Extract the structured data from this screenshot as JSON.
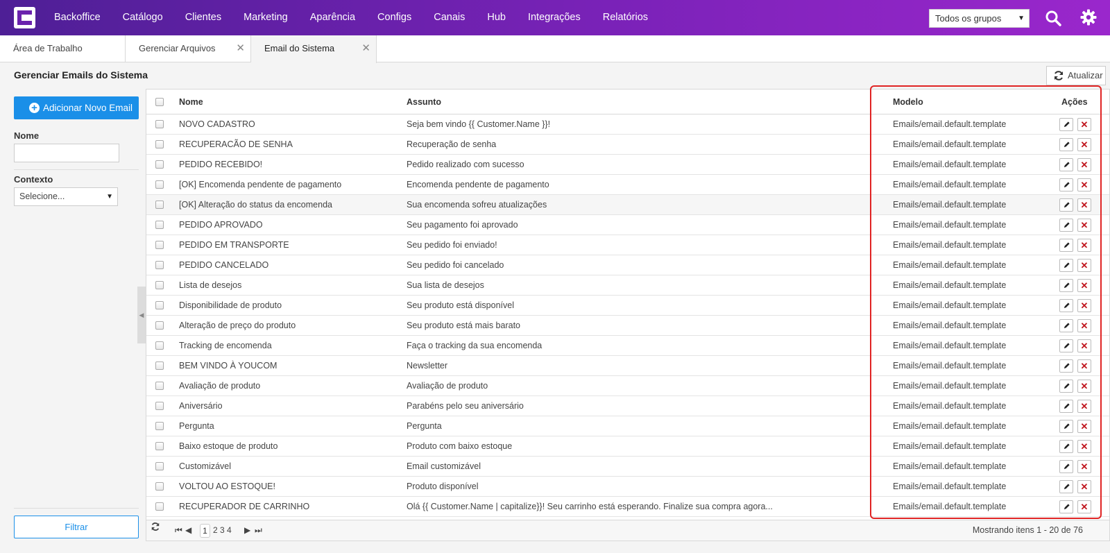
{
  "topbar": {
    "nav": [
      "Backoffice",
      "Catálogo",
      "Clientes",
      "Marketing",
      "Aparência",
      "Configs",
      "Canais",
      "Hub",
      "Integrações",
      "Relatórios"
    ],
    "group_select": "Todos os grupos"
  },
  "tabs": [
    "Área de Trabalho",
    "Gerenciar Arquivos",
    "Email do Sistema"
  ],
  "page": {
    "title": "Gerenciar Emails do Sistema",
    "refresh_label": "Atualizar"
  },
  "sidebar": {
    "add_label": "Adicionar Novo Email",
    "nome_label": "Nome",
    "contexto_label": "Contexto",
    "contexto_value": "Selecione...",
    "filter_label": "Filtrar"
  },
  "grid": {
    "columns": {
      "nome": "Nome",
      "assunto": "Assunto",
      "modelo": "Modelo",
      "acoes": "Ações"
    },
    "rows": [
      {
        "nome": "NOVO CADASTRO",
        "assunto": "Seja bem vindo {{ Customer.Name }}!",
        "modelo": "Emails/email.default.template"
      },
      {
        "nome": "RECUPERACÃO DE SENHA",
        "assunto": "Recuperação de senha",
        "modelo": "Emails/email.default.template"
      },
      {
        "nome": "PEDIDO RECEBIDO!",
        "assunto": "Pedido realizado com sucesso",
        "modelo": "Emails/email.default.template"
      },
      {
        "nome": "[OK] Encomenda pendente de pagamento",
        "assunto": "Encomenda pendente de pagamento",
        "modelo": "Emails/email.default.template"
      },
      {
        "nome": "[OK] Alteração do status da encomenda",
        "assunto": "Sua encomenda sofreu atualizações",
        "modelo": "Emails/email.default.template"
      },
      {
        "nome": "PEDIDO APROVADO",
        "assunto": "Seu pagamento foi aprovado",
        "modelo": "Emails/email.default.template"
      },
      {
        "nome": "PEDIDO EM TRANSPORTE",
        "assunto": "Seu pedido foi enviado!",
        "modelo": "Emails/email.default.template"
      },
      {
        "nome": "PEDIDO CANCELADO",
        "assunto": "Seu pedido foi cancelado",
        "modelo": "Emails/email.default.template"
      },
      {
        "nome": "Lista de desejos",
        "assunto": "Sua lista de desejos",
        "modelo": "Emails/email.default.template"
      },
      {
        "nome": "Disponibilidade de produto",
        "assunto": "Seu produto está disponível",
        "modelo": "Emails/email.default.template"
      },
      {
        "nome": "Alteração de preço do produto",
        "assunto": "Seu produto está mais barato",
        "modelo": "Emails/email.default.template"
      },
      {
        "nome": "Tracking de encomenda",
        "assunto": "Faça o tracking da sua encomenda",
        "modelo": "Emails/email.default.template"
      },
      {
        "nome": "BEM VINDO À YOUCOM",
        "assunto": "Newsletter",
        "modelo": "Emails/email.default.template"
      },
      {
        "nome": "Avaliação de produto",
        "assunto": "Avaliação de produto",
        "modelo": "Emails/email.default.template"
      },
      {
        "nome": "Aniversário",
        "assunto": "Parabéns pelo seu aniversário",
        "modelo": "Emails/email.default.template"
      },
      {
        "nome": "Pergunta",
        "assunto": "Pergunta",
        "modelo": "Emails/email.default.template"
      },
      {
        "nome": "Baixo estoque de produto",
        "assunto": "Produto com baixo estoque",
        "modelo": "Emails/email.default.template"
      },
      {
        "nome": "Customizável",
        "assunto": "Email customizável",
        "modelo": "Emails/email.default.template"
      },
      {
        "nome": "VOLTOU AO ESTOQUE!",
        "assunto": "Produto disponível",
        "modelo": "Emails/email.default.template"
      },
      {
        "nome": "RECUPERADOR DE CARRINHO",
        "assunto": "Olá {{ Customer.Name | capitalize}}! Seu carrinho está esperando. Finalize sua compra agora...",
        "modelo": "Emails/email.default.template"
      }
    ]
  },
  "pager": {
    "pages": [
      "1",
      "2",
      "3",
      "4"
    ],
    "current_page": "1",
    "info": "Mostrando itens 1 - 20 de 76"
  }
}
